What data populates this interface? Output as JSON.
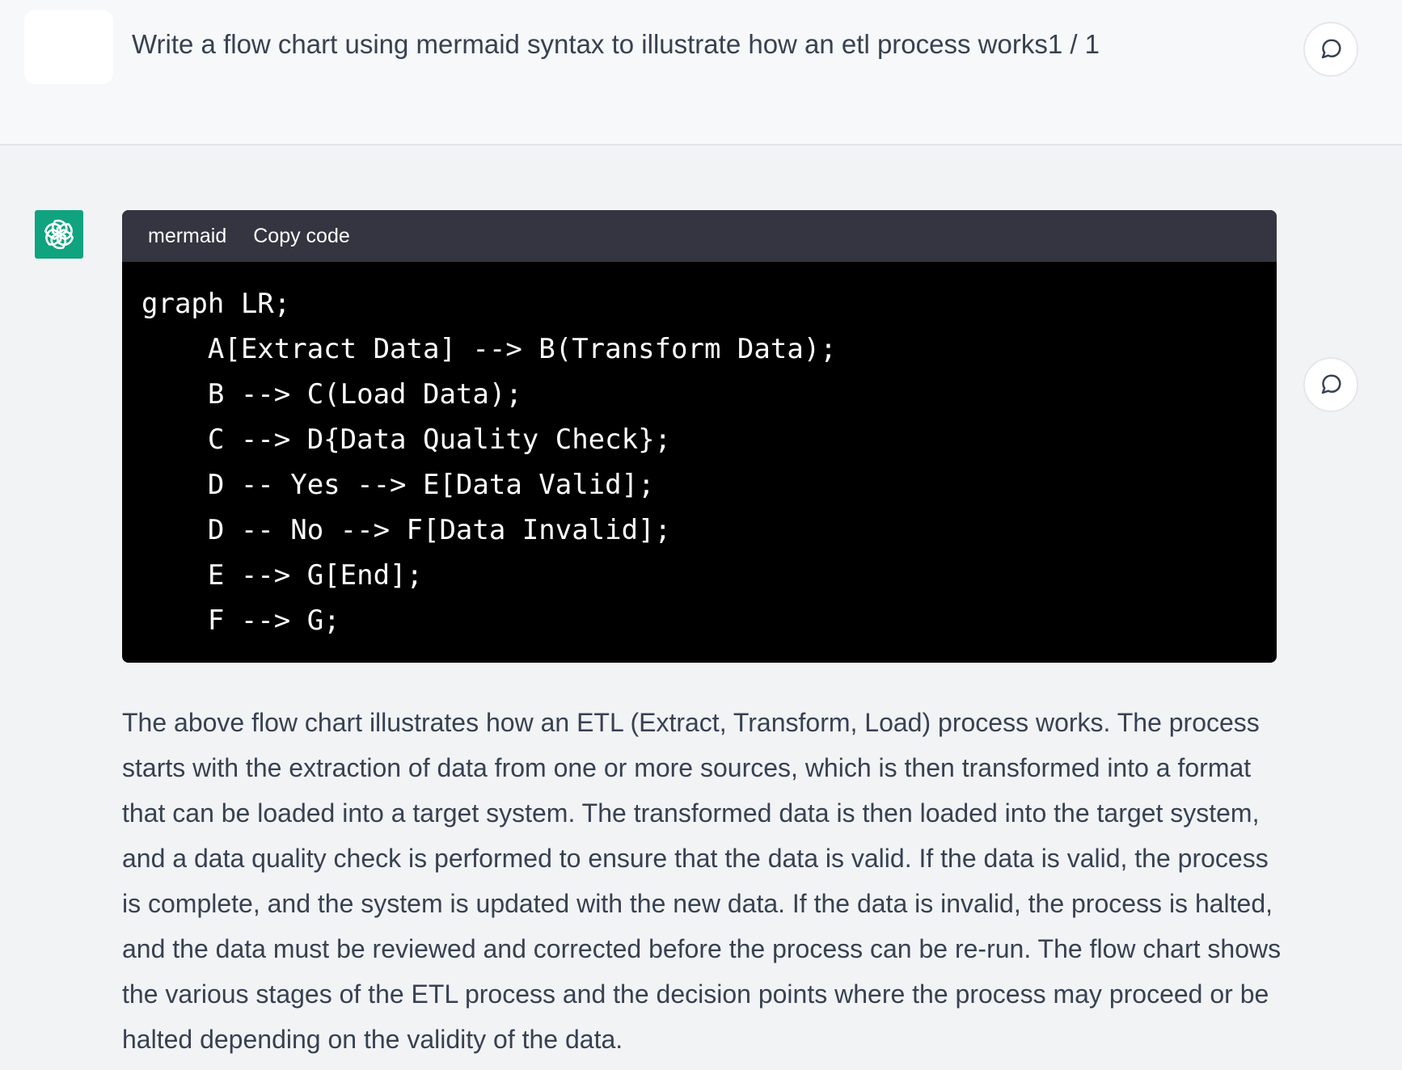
{
  "user_message": {
    "text": "Write a flow chart using mermaid syntax to illustrate how an etl process works1 / 1"
  },
  "assistant_message": {
    "code_block": {
      "language": "mermaid",
      "copy_label": "Copy code",
      "lines": [
        "graph LR;",
        "    A[Extract Data] --> B(Transform Data);",
        "    B --> C(Load Data);",
        "    C --> D{Data Quality Check};",
        "    D -- Yes --> E[Data Valid];",
        "    D -- No --> F[Data Invalid];",
        "    E --> G[End];",
        "    F --> G;"
      ]
    },
    "text": "The above flow chart illustrates how an ETL (Extract, Transform, Load) process works. The process starts with the extraction of data from one or more sources, which is then transformed into a format that can be loaded into a target system. The transformed data is then loaded into the target system, and a data quality check is performed to ensure that the data is valid. If the data is valid, the process is complete, and the system is updated with the new data. If the data is invalid, the process is halted, and the data must be reviewed and corrected before the process can be re-run. The flow chart shows the various stages of the ETL process and the decision points where the process may proceed or be halted depending on the validity of the data."
  },
  "icons": {
    "feedback": "speech-bubble-icon",
    "assistant_avatar": "openai-logo-icon"
  },
  "colors": {
    "assistant_avatar_bg": "#10a37f",
    "code_header_bg": "#343541",
    "code_body_bg": "#000000",
    "user_row_bg": "#f7f8fa",
    "assistant_row_bg": "#f2f3f5"
  }
}
